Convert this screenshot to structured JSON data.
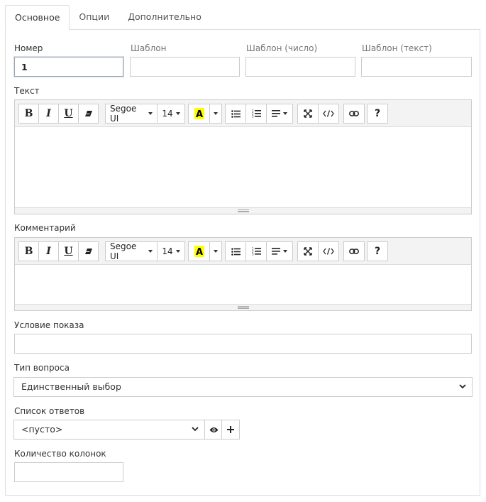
{
  "tabs": [
    {
      "label": "Основное",
      "active": true
    },
    {
      "label": "Опции",
      "active": false
    },
    {
      "label": "Дополнительно",
      "active": false
    }
  ],
  "fields": {
    "number": {
      "label": "Номер",
      "value": "1"
    },
    "template": {
      "label": "Шаблон",
      "value": ""
    },
    "template_number": {
      "label": "Шаблон (число)",
      "value": ""
    },
    "template_text": {
      "label": "Шаблон (текст)",
      "value": ""
    },
    "text": {
      "label": "Текст"
    },
    "comment": {
      "label": "Комментарий"
    },
    "show_condition": {
      "label": "Условие показа",
      "value": ""
    },
    "question_type": {
      "label": "Тип вопроса",
      "selected": "Единственный выбор"
    },
    "answer_list": {
      "label": "Список ответов",
      "selected": "<пусто>"
    },
    "columns_count": {
      "label": "Количество колонок",
      "value": ""
    }
  },
  "toolbar": {
    "font_name": "Segoe UI",
    "font_size": "14",
    "bold": "B",
    "italic": "I",
    "underline": "U",
    "help": "?",
    "highlight_color": "#ffff00"
  }
}
